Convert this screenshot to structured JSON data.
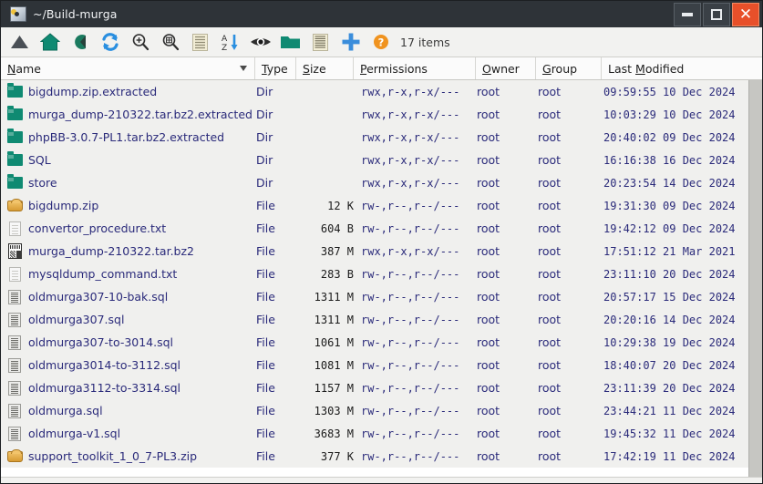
{
  "window": {
    "title": "~/Build-murga",
    "icon": "folder-image-icon",
    "buttons": {
      "minimize": "minimize-button",
      "maximize": "maximize-button",
      "close": "close-button"
    }
  },
  "toolbar": {
    "icons": [
      "up-arrow-icon",
      "home-icon",
      "back-icon",
      "refresh-icon",
      "zoom-in-icon",
      "zoom-out-icon",
      "list-view-icon",
      "sort-az-icon",
      "show-hidden-icon",
      "new-folder-icon",
      "detail-view-icon",
      "add-icon",
      "help-icon"
    ],
    "item_count": "17 items",
    "accent_blue": "#2a7fd4",
    "accent_teal": "#0f8a72",
    "accent_orange": "#f0931f"
  },
  "columns": [
    {
      "label": "Name",
      "mnemonic": "N",
      "sorted": true,
      "sort_dir": "descending"
    },
    {
      "label": "Type",
      "mnemonic": "T",
      "sorted": false,
      "sort_dir": ""
    },
    {
      "label": "Size",
      "mnemonic": "S",
      "sorted": false,
      "sort_dir": ""
    },
    {
      "label": "Permissions",
      "mnemonic": "P",
      "sorted": false,
      "sort_dir": ""
    },
    {
      "label": "Owner",
      "mnemonic": "O",
      "sorted": false,
      "sort_dir": ""
    },
    {
      "label": "Group",
      "mnemonic": "G",
      "sorted": false,
      "sort_dir": ""
    },
    {
      "label": "Last Modified",
      "mnemonic": "M",
      "sorted": false,
      "sort_dir": ""
    }
  ],
  "rows": [
    {
      "icon": "folder-icon",
      "name": "bigdump.zip.extracted",
      "type": "Dir",
      "size": "",
      "permissions": "rwx,r-x,r-x/---",
      "owner": "root",
      "group": "root",
      "modified": "09:59:55 10 Dec 2024"
    },
    {
      "icon": "folder-icon",
      "name": "murga_dump-210322.tar.bz2.extracted",
      "type": "Dir",
      "size": "",
      "permissions": "rwx,r-x,r-x/---",
      "owner": "root",
      "group": "root",
      "modified": "10:03:29 10 Dec 2024"
    },
    {
      "icon": "folder-icon",
      "name": "phpBB-3.0.7-PL1.tar.bz2.extracted",
      "type": "Dir",
      "size": "",
      "permissions": "rwx,r-x,r-x/---",
      "owner": "root",
      "group": "root",
      "modified": "20:40:02 09 Dec 2024"
    },
    {
      "icon": "folder-icon",
      "name": "SQL",
      "type": "Dir",
      "size": "",
      "permissions": "rwx,r-x,r-x/---",
      "owner": "root",
      "group": "root",
      "modified": "16:16:38 16 Dec 2024"
    },
    {
      "icon": "folder-icon",
      "name": "store",
      "type": "Dir",
      "size": "",
      "permissions": "rwx,r-x,r-x/---",
      "owner": "root",
      "group": "root",
      "modified": "20:23:54 14 Dec 2024"
    },
    {
      "icon": "zip-icon",
      "name": "bigdump.zip",
      "type": "File",
      "size": "12 K",
      "permissions": "rw-,r--,r--/---",
      "owner": "root",
      "group": "root",
      "modified": "19:31:30 09 Dec 2024"
    },
    {
      "icon": "text-file-icon",
      "name": "convertor_procedure.txt",
      "type": "File",
      "size": "604 B",
      "permissions": "rw-,r--,r--/---",
      "owner": "root",
      "group": "root",
      "modified": "19:42:12 09 Dec 2024"
    },
    {
      "icon": "archive-icon",
      "name": "murga_dump-210322.tar.bz2",
      "type": "File",
      "size": "387 M",
      "permissions": "rwx,r-x,r-x/---",
      "owner": "root",
      "group": "root",
      "modified": "17:51:12 21 Mar 2021"
    },
    {
      "icon": "text-file-icon",
      "name": "mysqldump_command.txt",
      "type": "File",
      "size": "283 B",
      "permissions": "rw-,r--,r--/---",
      "owner": "root",
      "group": "root",
      "modified": "23:11:10 20 Dec 2024"
    },
    {
      "icon": "sql-file-icon",
      "name": "oldmurga307-10-bak.sql",
      "type": "File",
      "size": "1311 M",
      "permissions": "rw-,r--,r--/---",
      "owner": "root",
      "group": "root",
      "modified": "20:57:17 15 Dec 2024"
    },
    {
      "icon": "sql-file-icon",
      "name": "oldmurga307.sql",
      "type": "File",
      "size": "1311 M",
      "permissions": "rw-,r--,r--/---",
      "owner": "root",
      "group": "root",
      "modified": "20:20:16 14 Dec 2024"
    },
    {
      "icon": "sql-file-icon",
      "name": "oldmurga307-to-3014.sql",
      "type": "File",
      "size": "1061 M",
      "permissions": "rw-,r--,r--/---",
      "owner": "root",
      "group": "root",
      "modified": "10:29:38 19 Dec 2024"
    },
    {
      "icon": "sql-file-icon",
      "name": "oldmurga3014-to-3112.sql",
      "type": "File",
      "size": "1081 M",
      "permissions": "rw-,r--,r--/---",
      "owner": "root",
      "group": "root",
      "modified": "18:40:07 20 Dec 2024"
    },
    {
      "icon": "sql-file-icon",
      "name": "oldmurga3112-to-3314.sql",
      "type": "File",
      "size": "1157 M",
      "permissions": "rw-,r--,r--/---",
      "owner": "root",
      "group": "root",
      "modified": "23:11:39 20 Dec 2024"
    },
    {
      "icon": "sql-file-icon",
      "name": "oldmurga.sql",
      "type": "File",
      "size": "1303 M",
      "permissions": "rw-,r--,r--/---",
      "owner": "root",
      "group": "root",
      "modified": "23:44:21 11 Dec 2024"
    },
    {
      "icon": "sql-file-icon",
      "name": "oldmurga-v1.sql",
      "type": "File",
      "size": "3683 M",
      "permissions": "rw-,r--,r--/---",
      "owner": "root",
      "group": "root",
      "modified": "19:45:32 11 Dec 2024"
    },
    {
      "icon": "zip-icon",
      "name": "support_toolkit_1_0_7-PL3.zip",
      "type": "File",
      "size": "377 K",
      "permissions": "rw-,r--,r--/---",
      "owner": "root",
      "group": "root",
      "modified": "17:42:19 11 Dec 2024"
    }
  ]
}
